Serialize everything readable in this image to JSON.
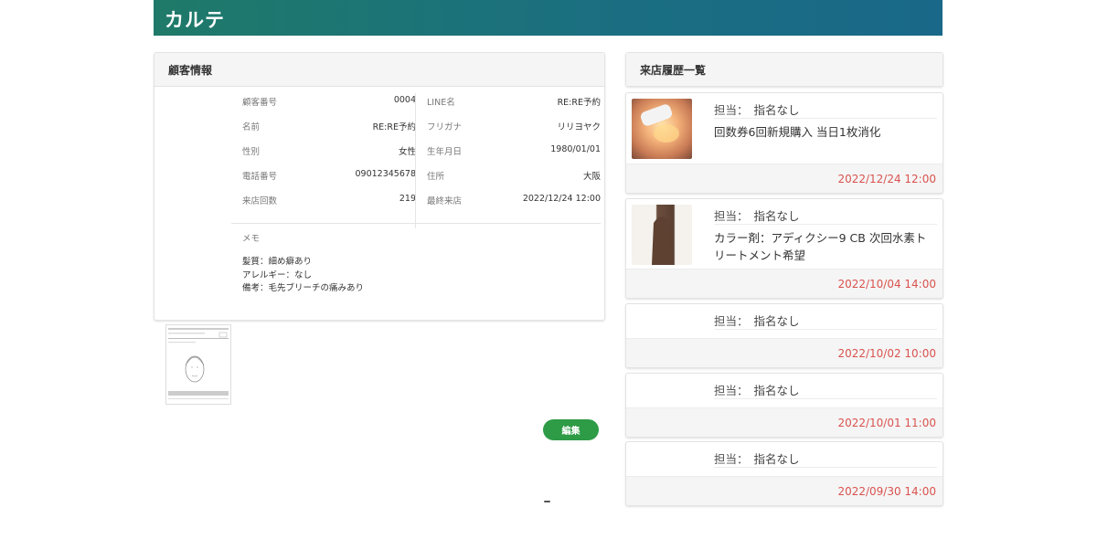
{
  "header": {
    "title": "カルテ"
  },
  "customer": {
    "heading": "顧客情報",
    "left_rows": [
      {
        "label": "顧客番号",
        "value": "0004"
      },
      {
        "label": "名前",
        "value": "RE:RE予約"
      },
      {
        "label": "性別",
        "value": "女性"
      },
      {
        "label": "電話番号",
        "value": "09012345678"
      },
      {
        "label": "来店回数",
        "value": "219"
      }
    ],
    "right_rows": [
      {
        "label": "LINE名",
        "value": "RE:RE予約"
      },
      {
        "label": "フリガナ",
        "value": "リリヨヤク"
      },
      {
        "label": "生年月日",
        "value": "1980/01/01"
      },
      {
        "label": "住所",
        "value": "大阪"
      },
      {
        "label": "最終来店",
        "value": "2022/12/24 12:00"
      }
    ],
    "memo_label": "メモ",
    "memo_lines": [
      "髪質：細め癖あり",
      "アレルギー：なし",
      "備考：毛先ブリーチの痛みあり"
    ]
  },
  "edit_button": "編集",
  "history": {
    "heading": "来店履歴一覧",
    "staff_label": "担当：",
    "visits": [
      {
        "staff": "指名なし",
        "description": "回数券6回新規購入 当日1枚消化",
        "date": "2022/12/24 12:00",
        "photo": "beauty-device-photo"
      },
      {
        "staff": "指名なし",
        "description": "カラー剤：アディクシー9 CB 次回水素トリートメント希望",
        "date": "2022/10/04 14:00",
        "photo": "hair-photo"
      },
      {
        "staff": "指名なし",
        "description": "",
        "date": "2022/10/02 10:00",
        "photo": ""
      },
      {
        "staff": "指名なし",
        "description": "",
        "date": "2022/10/01 11:00",
        "photo": ""
      },
      {
        "staff": "指名なし",
        "description": "",
        "date": "2022/09/30 14:00",
        "photo": ""
      }
    ]
  },
  "colors": {
    "header_start": "#1f7a69",
    "header_end": "#196889",
    "edit_button": "#2e9b46",
    "date_text": "#d9534f"
  }
}
